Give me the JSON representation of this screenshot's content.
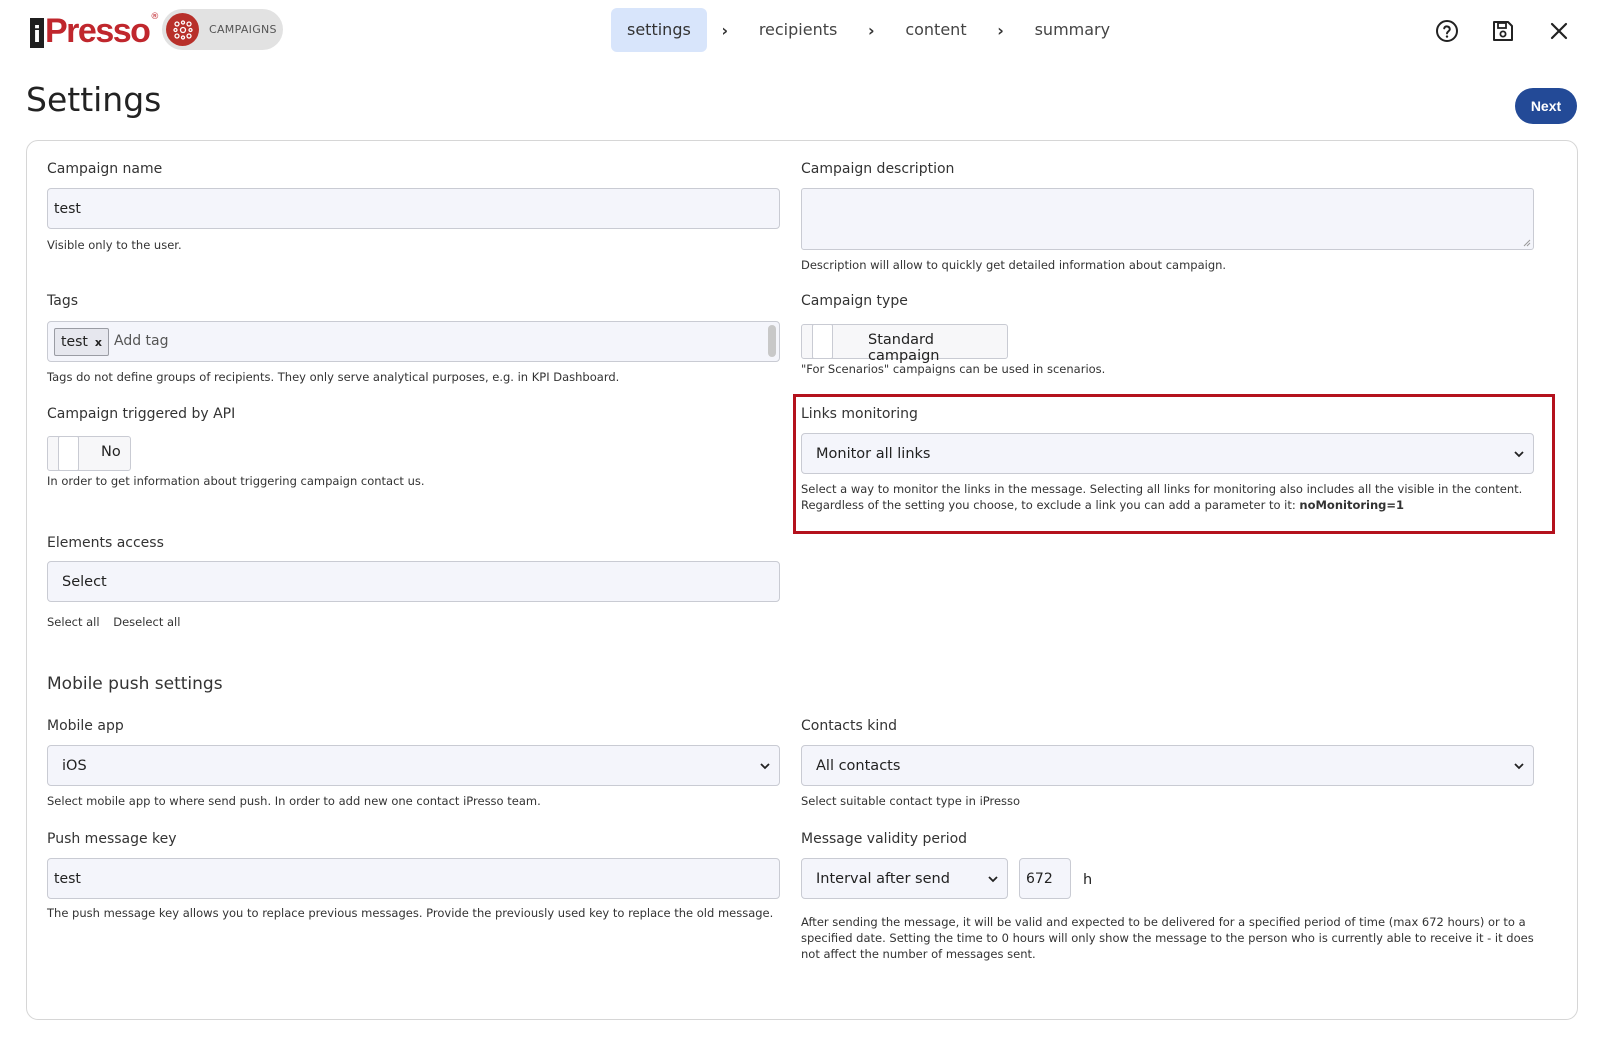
{
  "brand": {
    "logo_text": "iPresso",
    "module_label": "CAMPAIGNS"
  },
  "steps": [
    "settings",
    "recipients",
    "content",
    "summary"
  ],
  "step_separator": "›",
  "colors": {
    "brand_red": "#c0272d",
    "next_button": "#234a97",
    "active_step": "#d8e5fb",
    "highlight_border": "#b4111d"
  },
  "icons": {
    "help": "help-circle-icon",
    "save": "save-icon",
    "close": "close-icon"
  },
  "page_title": "Settings",
  "next_label": "Next",
  "campaign_name": {
    "label": "Campaign name",
    "value": "test",
    "help": "Visible only to the user."
  },
  "campaign_description": {
    "label": "Campaign description",
    "value": "",
    "help": "Description will allow to quickly get detailed information about campaign."
  },
  "tags": {
    "label": "Tags",
    "chip": "test",
    "chip_remove": "x",
    "placeholder": "Add tag",
    "help": "Tags do not define groups of recipients. They only serve analytical purposes, e.g. in KPI Dashboard."
  },
  "campaign_type": {
    "label": "Campaign type",
    "value": "Standard campaign",
    "help": "\"For Scenarios\" campaigns can be used in scenarios."
  },
  "triggered_by_api": {
    "label": "Campaign triggered by API",
    "value": "No",
    "help": "In order to get information about triggering campaign contact us."
  },
  "links_monitoring": {
    "label": "Links monitoring",
    "value": "Monitor all links",
    "help_line1": "Select a way to monitor the links in the message. Selecting all links for monitoring also includes all the visible in the content.",
    "help_line2": "Regardless of the setting you choose, to exclude a link you can add a parameter to it: ",
    "help_code": "noMonitoring=1"
  },
  "elements_access": {
    "label": "Elements access",
    "value": "Select",
    "select_all": "Select all",
    "deselect_all": "Deselect all"
  },
  "mobile_push": {
    "title": "Mobile push settings",
    "mobile_app": {
      "label": "Mobile app",
      "value": "iOS",
      "help": "Select mobile app to where send push. In order to add new one contact iPresso team."
    },
    "contacts_kind": {
      "label": "Contacts kind",
      "value": "All contacts",
      "help": "Select suitable contact type in iPresso"
    },
    "push_key": {
      "label": "Push message key",
      "value": "test",
      "help": "The push message key allows you to replace previous messages. Provide the previously used key to replace the old message."
    },
    "validity": {
      "label": "Message validity period",
      "mode": "Interval after send",
      "hours": "672",
      "unit": "h",
      "help_line1": "After sending the message, it will be valid and expected to be delivered for a specified period of time (max 672 hours) or to a",
      "help_line2": "specified date. Setting the time to 0 hours will only show the message to the person who is currently able to receive it - it does",
      "help_line3": "not affect the number of messages sent."
    }
  }
}
